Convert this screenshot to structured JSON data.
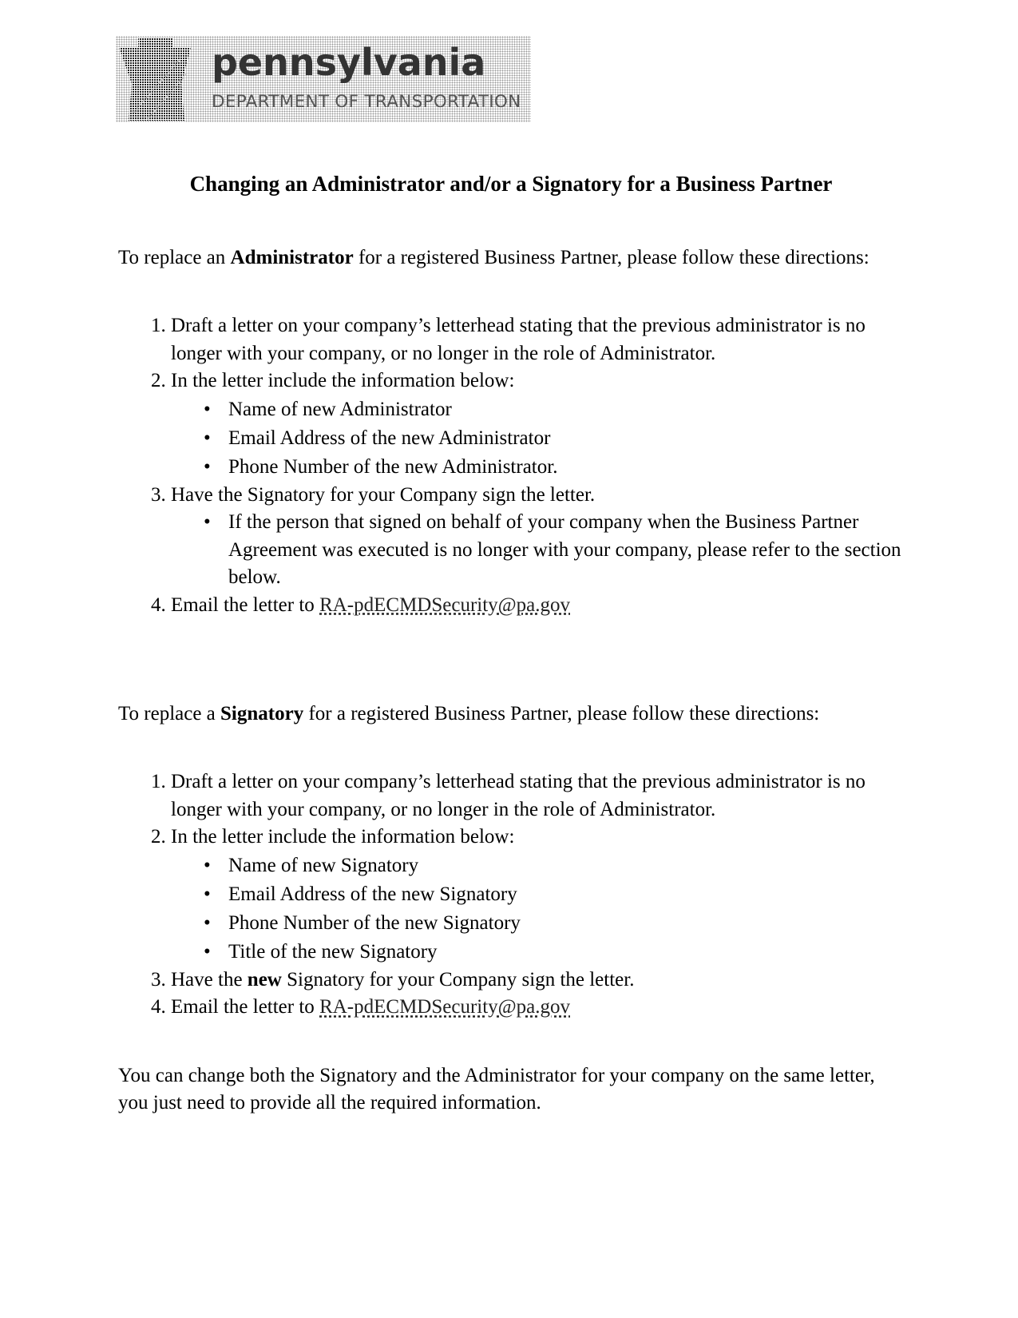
{
  "header": {
    "logo_name": "pennsylvania",
    "logo_department": "DEPARTMENT OF TRANSPORTATION",
    "logo_icon": "keystone-icon"
  },
  "title": "Changing an Administrator and/or a Signatory for a Business Partner",
  "administrator_section": {
    "intro_before": "To replace an ",
    "intro_bold": "Administrator",
    "intro_after": " for a registered Business Partner, please follow these directions:",
    "steps": [
      {
        "text": "Draft a letter on your company’s letterhead stating that the previous administrator is no longer with your company, or no longer in the role of Administrator."
      },
      {
        "text": "In the letter include the information below:",
        "bullets": [
          "Name of new Administrator",
          "Email Address of the new Administrator",
          "Phone Number of the new Administrator."
        ]
      },
      {
        "text": "Have the Signatory for your Company sign the letter.",
        "bullets": [
          "If the person that signed on behalf of your company when the Business Partner Agreement was executed is no longer with your company, please refer to the section below."
        ]
      },
      {
        "text": "Email the letter to ",
        "email": "RA-pdECMDSecurity@pa.gov"
      }
    ]
  },
  "signatory_section": {
    "intro_before": "To replace a ",
    "intro_bold": "Signatory",
    "intro_after": " for a registered Business Partner, please follow these directions:",
    "steps": [
      {
        "text": "Draft a letter on your company’s letterhead stating that the previous administrator is no longer with your company, or no longer in the role of Administrator."
      },
      {
        "text": "In the letter include the information below:",
        "bullets": [
          "Name of new Signatory",
          "Email Address of the new Signatory",
          "Phone Number of the new Signatory",
          "Title of the new Signatory"
        ]
      },
      {
        "text_before": "Have the ",
        "text_bold": "new",
        "text_after": " Signatory for your Company sign the letter."
      },
      {
        "text": "Email the letter to ",
        "email": "RA-pdECMDSecurity@pa.gov"
      }
    ]
  },
  "closing": "You can change both the Signatory and the Administrator for your company on the same letter, you just need to provide all the required information."
}
